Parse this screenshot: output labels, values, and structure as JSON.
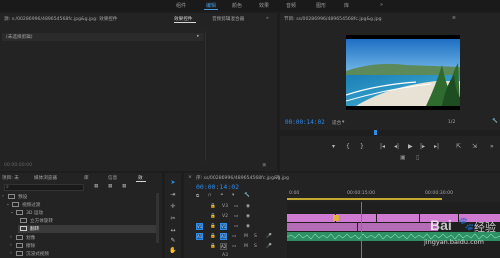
{
  "workspace": {
    "tabs": [
      "组件",
      "编辑",
      "颜色",
      "效果",
      "音频",
      "图形",
      "库"
    ],
    "active_index": 1
  },
  "source_panel": {
    "path": "源: s:/00286996/489654568fc.jpg&g.jpg: 效果控件",
    "tab_effect_controls": "效果控件",
    "tab_audio_mixer": "音频剪辑混合器",
    "no_clip_selected": "(未选择剪辑)",
    "timecode": "00:00:00:00"
  },
  "program_panel": {
    "title": "节目: ss/00286996/489654568fc.jpg&g.jpg",
    "timecode": "00:00:14:02",
    "fit_label": "适合",
    "quality": "1/2"
  },
  "project_panel": {
    "tabs": [
      "项目: 未",
      "媒体浏览器",
      "库",
      "信息",
      "效"
    ],
    "items": [
      {
        "label": "预设",
        "level": 0
      },
      {
        "label": "视频过渡",
        "level": 1
      },
      {
        "label": "3D 运动",
        "level": 2
      },
      {
        "label": "立方体旋转",
        "level": 3
      },
      {
        "label": "翻转",
        "level": 3
      },
      {
        "label": "划像",
        "level": 2
      },
      {
        "label": "擦除",
        "level": 2
      },
      {
        "label": "沉浸式视频",
        "level": 2
      }
    ]
  },
  "timeline": {
    "title": "序: ss/00286996/489654568fc.jpg&g.jpg",
    "timecode": "00:00:14:02",
    "ruler": [
      "0:00",
      "00:00:15:00",
      "00:00:30:00"
    ],
    "tracks": [
      {
        "label": "V3"
      },
      {
        "label": "V2"
      },
      {
        "label": "V1"
      },
      {
        "label": "A1"
      },
      {
        "label": "A2"
      },
      {
        "label": "A3"
      }
    ],
    "track_buttons": [
      "M",
      "S"
    ]
  },
  "watermark": {
    "logo_text": "Bai",
    "brand": "经验",
    "url": "jingyan.baidu.com"
  },
  "ime": {
    "logo": "S",
    "label": "中"
  },
  "colors": {
    "accent": "#2d8ceb",
    "clip_pink": "#d07ad2",
    "clip_green": "#2e8f64",
    "playhead": "#2d8ceb"
  }
}
